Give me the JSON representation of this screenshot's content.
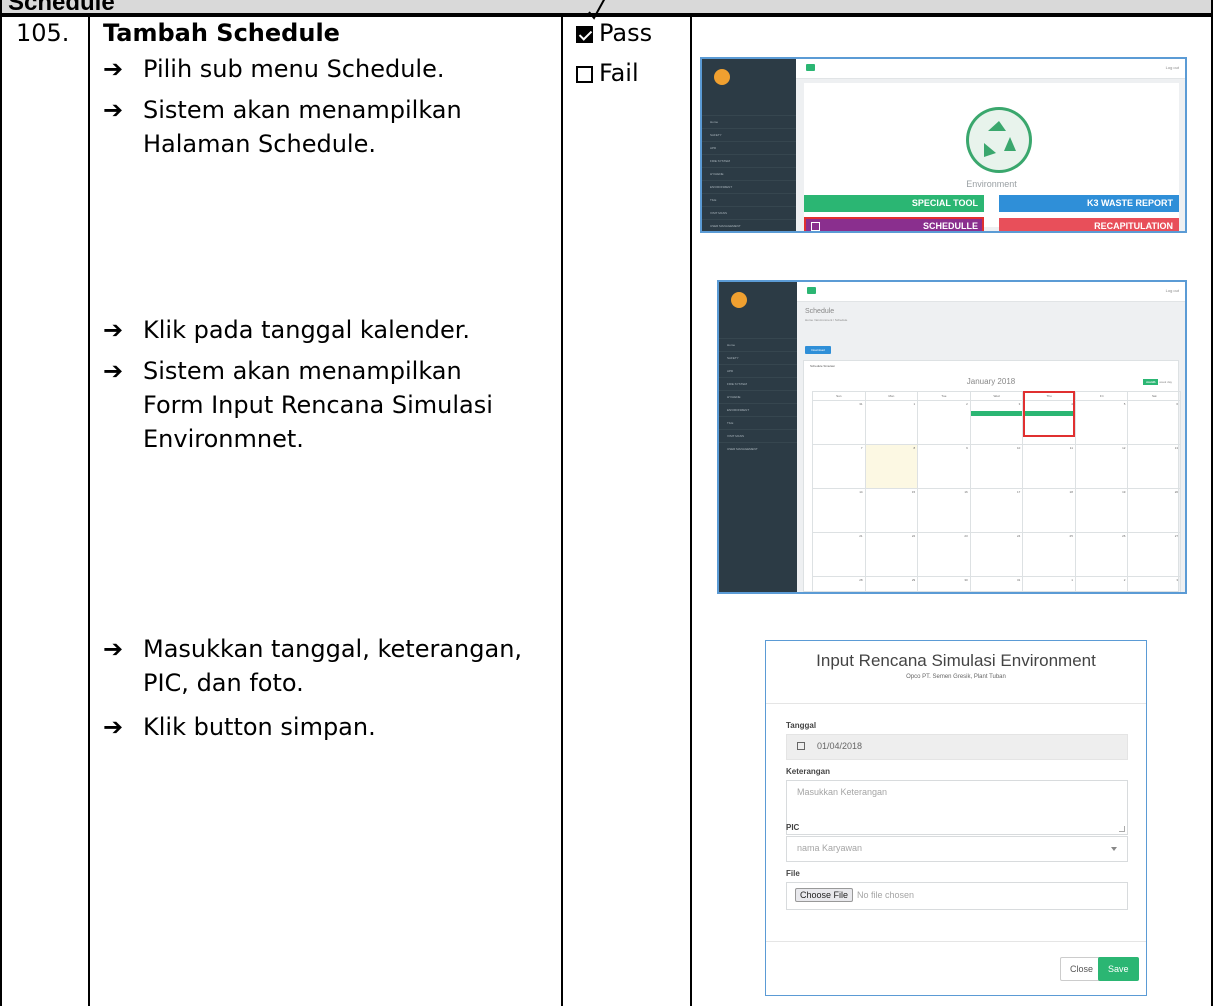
{
  "header": {
    "section_title": "Schedule"
  },
  "row": {
    "number": "105.",
    "title": "Tambah Schedule",
    "steps_group1": [
      "Pilih sub menu Schedule.",
      "Sistem akan menampilkan\nHalaman Schedule."
    ],
    "steps_group2": [
      "Klik pada tanggal kalender.",
      "Sistem akan menampilkan\nForm Input Rencana Simulasi\nEnvironmnet."
    ],
    "steps_group3": [
      "Masukkan tanggal, keterangan,\nPIC, dan foto.",
      "Klik button simpan."
    ],
    "result": {
      "pass_label": "Pass",
      "fail_label": "Fail",
      "pass_checked": true,
      "fail_checked": false
    }
  },
  "screenshot1": {
    "logout": "Log out",
    "sidebar_items": [
      "Home",
      "SAFETY",
      "APD",
      "FIRE SYSTEM",
      "HYGIENE",
      "ENVIRONMENT",
      "TILE",
      "VISIT MANS",
      "USER MANAGEMENT"
    ],
    "caption": "Environment",
    "tiles": [
      "SPECIAL TOOL",
      "K3 WASTE REPORT",
      "SCHEDULLE",
      "RECAPITULATION"
    ]
  },
  "screenshot2": {
    "logout": "Log out",
    "page_title": "Schedule",
    "breadcrumb": "Home / Environment / Schedule",
    "download_btn": "Download",
    "panel_title": "Schedule Simulasi",
    "month": "January 2018",
    "view_buttons": [
      "month",
      "week",
      "day"
    ],
    "weekdays": [
      "Sun",
      "Mon",
      "Tue",
      "Wed",
      "Thu",
      "Fri",
      "Sat"
    ],
    "weeks": [
      [
        "31",
        "1",
        "2",
        "3",
        "4",
        "5",
        "6"
      ],
      [
        "7",
        "8",
        "9",
        "10",
        "11",
        "12",
        "13"
      ],
      [
        "14",
        "15",
        "16",
        "17",
        "18",
        "19",
        "20"
      ],
      [
        "21",
        "22",
        "23",
        "24",
        "25",
        "26",
        "27"
      ],
      [
        "28",
        "29",
        "30",
        "31",
        "1",
        "2",
        "3"
      ]
    ]
  },
  "modal": {
    "title": "Input Rencana Simulasi Environment",
    "subtitle": "Opco PT. Semen Gresik, Plant Tuban",
    "tanggal_label": "Tanggal",
    "tanggal_value": "01/04/2018",
    "keterangan_label": "Keterangan",
    "keterangan_placeholder": "Masukkan Keterangan",
    "pic_label": "PIC",
    "pic_value": "nama Karyawan",
    "file_label": "File",
    "choose_file": "Choose File",
    "no_file": "No file chosen",
    "close_btn": "Close",
    "save_btn": "Save"
  }
}
